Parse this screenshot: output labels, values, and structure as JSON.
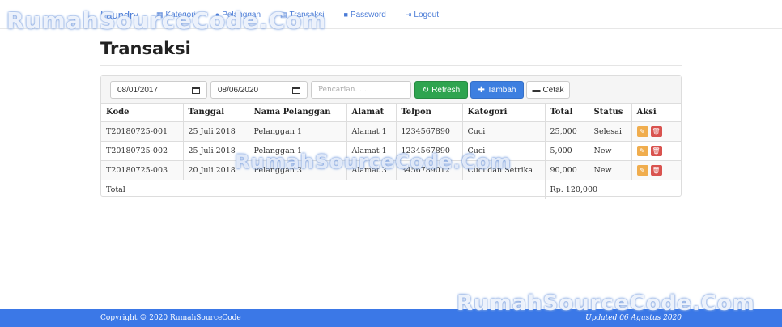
{
  "nav": {
    "brand": "Laundry",
    "items": [
      {
        "label": "Kategori",
        "icon": "grid-icon"
      },
      {
        "label": "Pelanggan",
        "icon": "user-icon"
      },
      {
        "label": "Transaksi",
        "icon": "table-icon"
      },
      {
        "label": "Password",
        "icon": "lock-icon"
      },
      {
        "label": "Logout",
        "icon": "logout-icon"
      }
    ]
  },
  "watermark": "RumahSourceCode.Com",
  "page": {
    "title": "Transaksi"
  },
  "toolbar": {
    "date_from": "08/01/2017",
    "date_to": "08/06/2020",
    "search_placeholder": "Pencarian. . .",
    "refresh_label": "Refresh",
    "add_label": "Tambah",
    "print_label": "Cetak"
  },
  "table": {
    "headers": [
      "Kode",
      "Tanggal",
      "Nama Pelanggan",
      "Alamat",
      "Telpon",
      "Kategori",
      "Total",
      "Status",
      "Aksi"
    ],
    "rows": [
      [
        "T20180725-001",
        "25 Juli 2018",
        "Pelanggan 1",
        "Alamat 1",
        "1234567890",
        "Cuci",
        "25,000",
        "Selesai"
      ],
      [
        "T20180725-002",
        "25 Juli 2018",
        "Pelanggan 1",
        "Alamat 1",
        "1234567890",
        "Cuci",
        "5,000",
        "New"
      ],
      [
        "T20180725-003",
        "20 Juli 2018",
        "Pelanggan 3",
        "Alamat 3",
        "3456789012",
        "Cuci dan Setrika",
        "90,000",
        "New"
      ]
    ],
    "total_label": "Total",
    "total_value": "Rp. 120,000"
  },
  "footer": {
    "copyright": "Copyright © 2020 RumahSourceCode",
    "updated": "Updated 06 Agustus 2020"
  },
  "colors": {
    "accent": "#3b78e7",
    "refresh": "#2ea44f",
    "add": "#3d7fe0",
    "edit": "#f0ad4e",
    "delete": "#d9534f"
  }
}
